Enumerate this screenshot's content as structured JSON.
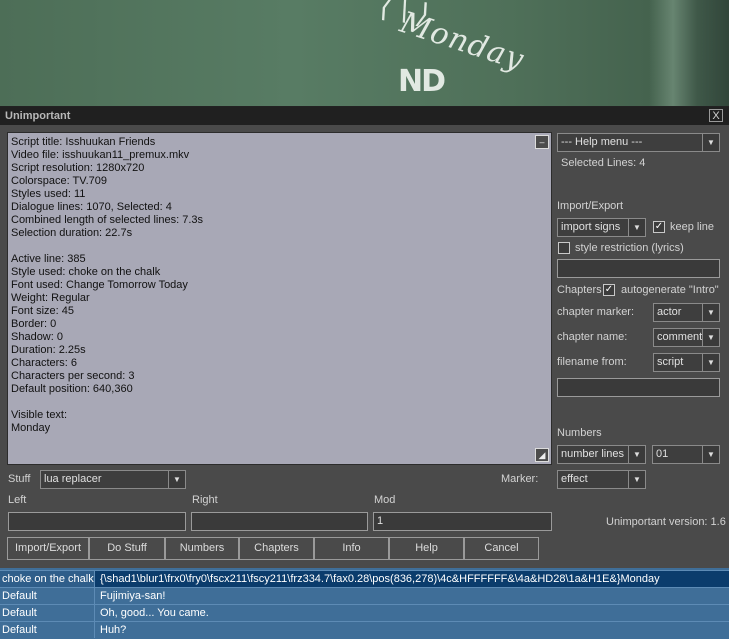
{
  "video": {
    "chalk_text": "Monday"
  },
  "dialog": {
    "title": "Unimportant",
    "close_label": "X",
    "info_lines": [
      "Script title: Isshuukan Friends",
      "Video file: isshuukan11_premux.mkv",
      "Script resolution: 1280x720",
      "Colorspace: TV.709",
      "Styles used: 11",
      "Dialogue lines: 1070, Selected: 4",
      "Combined length of selected lines: 7.3s",
      "Selection duration: 22.7s",
      "",
      "Active line: 385",
      "Style used: choke on the chalk",
      "Font used: Change Tomorrow Today",
      "Weight: Regular",
      "Font size: 45",
      "Border: 0",
      "Shadow: 0",
      "Duration: 2.25s",
      "Characters: 6",
      "Characters per second: 3",
      "Default position: 640,360",
      "",
      "Visible text:",
      "Monday"
    ],
    "right": {
      "help_menu": "--- Help menu ---",
      "selected_lines": "Selected Lines: 4",
      "import_export_label": "Import/Export",
      "import_select": "import signs",
      "keep_line_label": "keep line",
      "keep_line_checked": true,
      "style_restriction_label": "style restriction (lyrics)",
      "style_restriction_checked": false,
      "import_text": "",
      "chapters_label": "Chapters",
      "autogenerate_label": "autogenerate \"Intro\"",
      "autogenerate_checked": true,
      "chapter_marker_label": "chapter marker:",
      "chapter_marker_value": "actor",
      "chapter_name_label": "chapter name:",
      "chapter_name_value": "comment",
      "filename_from_label": "filename from:",
      "filename_from_value": "script",
      "filename_text": "",
      "numbers_label": "Numbers",
      "numbers_select": "number lines",
      "numbers_start": "01",
      "marker_label": "Marker:",
      "marker_value": "effect",
      "version": "Unimportant version: 1.6"
    },
    "stuff_label": "Stuff",
    "stuff_select": "lua replacer",
    "left_label": "Left",
    "right_label": "Right",
    "mod_label": "Mod",
    "left_value": "",
    "right_value": "",
    "mod_value": "1",
    "buttons": [
      "Import/Export",
      "Do Stuff",
      "Numbers",
      "Chapters",
      "Info",
      "Help",
      "Cancel"
    ]
  },
  "grid": {
    "rows": [
      {
        "style": "choke on the chalk",
        "text": "{\\shad1\\blur1\\frx0\\fry0\\fscx211\\fscy211\\frz334.7\\fax0.28\\pos(836,278)\\4c&HFFFFFF&\\4a&HD28\\1a&H1E&}Monday",
        "active": true
      },
      {
        "style": "Default",
        "text": "Fujimiya-san!",
        "active": false
      },
      {
        "style": "Default",
        "text": "Oh, good... You came.",
        "active": false
      },
      {
        "style": "Default",
        "text": "Huh?",
        "active": false
      }
    ]
  },
  "colors": {
    "dialog_bg": "#4a4a4a",
    "info_bg": "#a8a8b6",
    "grid_bg": "#3f6e98",
    "active_row": "#0b3c6c"
  }
}
